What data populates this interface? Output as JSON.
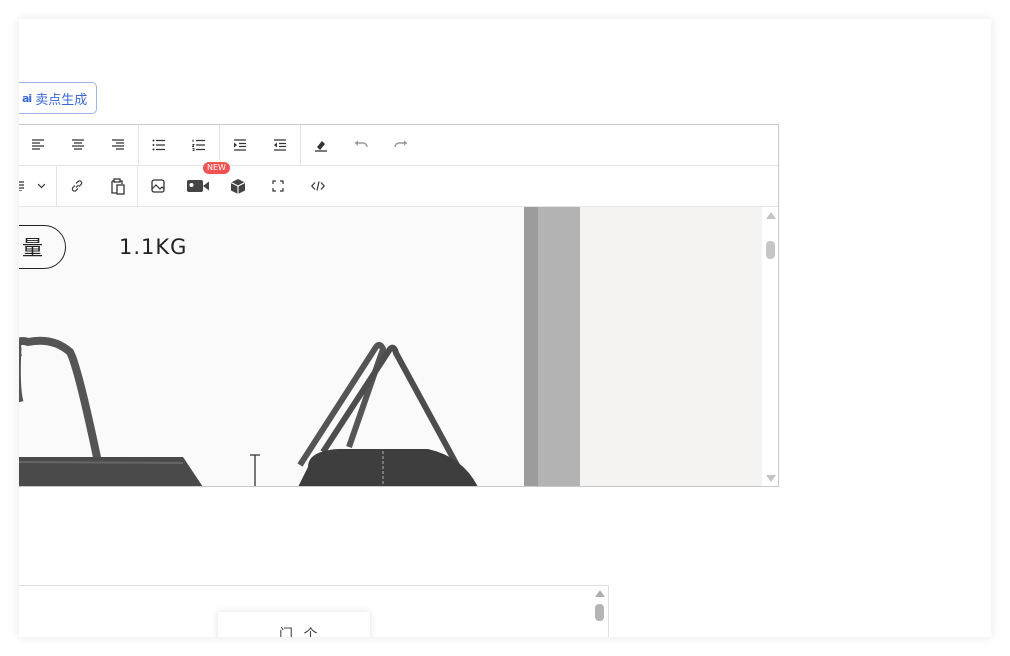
{
  "ai_button": {
    "icon": "ai-icon",
    "label": "卖点生成"
  },
  "toolbar": {
    "row1": [
      "align-left-icon",
      "align-center-icon",
      "align-right-icon",
      "bullet-list-icon",
      "numbered-list-icon",
      "indent-icon",
      "outdent-icon",
      "eraser-icon",
      "undo-icon",
      "redo-icon"
    ],
    "row2": [
      "format-dropdown-icon",
      "link-icon",
      "paste-icon",
      "image-icon",
      "video-icon",
      "3d-box-icon",
      "fullscreen-icon",
      "code-view-icon"
    ],
    "video_badge": "NEW"
  },
  "content": {
    "spec_label": "量",
    "spec_value": "1.1KG"
  },
  "popup": {
    "text": "门 个"
  },
  "colors": {
    "accent": "#3a68d6",
    "badge": "#f05252"
  }
}
